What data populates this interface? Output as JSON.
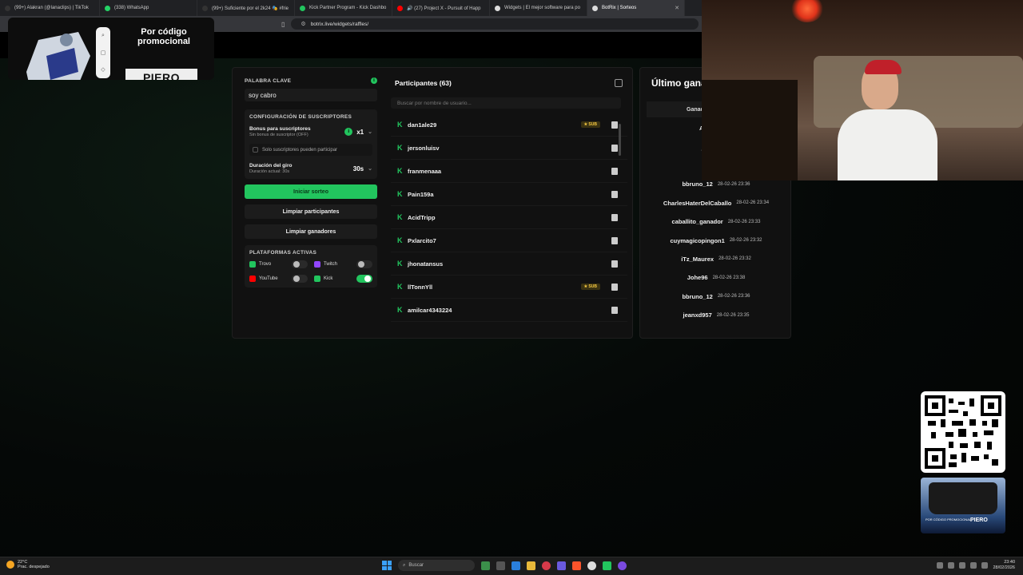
{
  "browser": {
    "tabs": [
      {
        "label": "(99+) Alakran (@lanaclips) | TikTok",
        "color": "#333333"
      },
      {
        "label": "(338) WhatsApp",
        "color": "#25d366"
      },
      {
        "label": "(99+) Suficiente por el 2k24 🎭 #frie",
        "color": "#333333"
      },
      {
        "label": "Kick Partner Program - Kick Dashbo",
        "color": "#22c55e"
      },
      {
        "label": "🔊 (27) Project X - Pursuit of Happ",
        "color": "#ff0000"
      },
      {
        "label": "Widgets | El mejor software para po",
        "color": "#dddddd"
      },
      {
        "label": "BotRix | Sorteos",
        "color": "#dddddd"
      }
    ],
    "url": "botrix.live/widgets/raffles/"
  },
  "promo": {
    "line1": "Por código",
    "line2": "promocional",
    "code": "PIERO"
  },
  "raffle": {
    "keyword_label": "PALABRA CLAVE",
    "keyword_value": "soy cabro",
    "sub_config_label": "CONFIGURACIÓN DE SUSCRIPTORES",
    "bonus_title": "Bonus para suscriptores",
    "bonus_sub": "Sin bonus de suscriptor (OFF)",
    "bonus_value": "x1",
    "only_subs_label": "Solo suscriptores pueden participar",
    "duration_title": "Duración del giro",
    "duration_sub": "Duración actual: 30s",
    "duration_value": "30s",
    "start_button": "Iniciar sorteo",
    "clear_participants": "Limpiar participantes",
    "clear_winners": "Limpiar ganadores",
    "platforms_label": "PLATAFORMAS ACTIVAS",
    "platforms": [
      {
        "name": "Trovo",
        "color": "#22c55e",
        "on": false
      },
      {
        "name": "Twitch",
        "color": "#9146ff",
        "on": false
      },
      {
        "name": "YouTube",
        "color": "#ff0000",
        "on": false
      },
      {
        "name": "Kick",
        "color": "#22c55e",
        "on": true
      }
    ]
  },
  "participants": {
    "title": "Participantes (63)",
    "search_placeholder": "Buscar por nombre de usuario...",
    "sub_badge": "★ SUB",
    "items": [
      {
        "name": "dan1ale29",
        "sub": true
      },
      {
        "name": "jersonluisv",
        "sub": false
      },
      {
        "name": "franmenaaa",
        "sub": false
      },
      {
        "name": "Pain159a",
        "sub": false
      },
      {
        "name": "AcidTripp",
        "sub": false
      },
      {
        "name": "Pxlarcito7",
        "sub": false
      },
      {
        "name": "jhonatansus",
        "sub": false
      },
      {
        "name": "llTonnYll",
        "sub": true
      },
      {
        "name": "amilcar4343224",
        "sub": false
      }
    ]
  },
  "winners": {
    "title": "Último gana",
    "column": "Ganad",
    "items": [
      {
        "name": "Alonsolaval",
        "date": ""
      },
      {
        "name": "jeanxd957",
        "date": ""
      },
      {
        "name": "Johe96",
        "date": ""
      },
      {
        "name": "bbruno_12",
        "date": "28-02-26 23:36"
      },
      {
        "name": "CharlesHaterDelCaballo",
        "date": "28-02-26 23:34"
      },
      {
        "name": "caballito_ganador",
        "date": "28-02-26 23:33"
      },
      {
        "name": "cuymagicopingon1",
        "date": "28-02-26 23:32"
      },
      {
        "name": "iTz_Maurex",
        "date": "28-02-26 23:32"
      },
      {
        "name": "Johe96",
        "date": "28-02-26 23:38"
      },
      {
        "name": "bbruno_12",
        "date": "28-02-26 23:36"
      },
      {
        "name": "jeanxd957",
        "date": "28-02-26 23:35"
      }
    ]
  },
  "promo2": {
    "line": "POR CÓDIGO PROMOCIONAL",
    "code": "PIERO"
  },
  "taskbar": {
    "temp": "22°C",
    "weather": "Prac. despejado",
    "search": "Buscar",
    "time": "23:40",
    "date": "28/02/2026"
  }
}
